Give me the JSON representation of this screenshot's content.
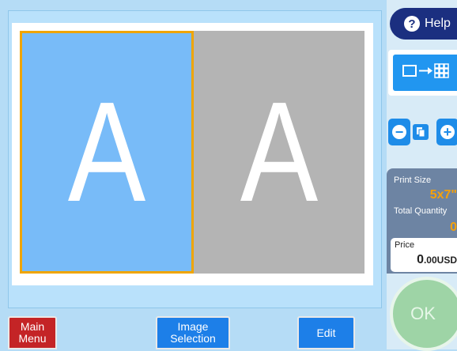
{
  "header": {
    "help_label": "Help"
  },
  "layout_button": {
    "icon": "single-to-grid-icon"
  },
  "zoom": {
    "minus": "−",
    "plus": "+",
    "icon": "page-icon"
  },
  "canvas": {
    "slots": [
      {
        "letter": "A",
        "selected": true,
        "color": "#78bbf8"
      },
      {
        "letter": "A",
        "selected": false,
        "color": "#b4b4b4"
      }
    ]
  },
  "info": {
    "print_size_label": "Print Size",
    "print_size_value": "5x7\"",
    "total_quantity_label": "Total Quantity",
    "total_quantity_value": "0",
    "price_label": "Price",
    "price_value_main": "0",
    "price_value_rest": ".00USD"
  },
  "buttons": {
    "main_menu_line1": "Main",
    "main_menu_line2": "Menu",
    "image_selection_line1": "Image",
    "image_selection_line2": "Selection",
    "edit": "Edit",
    "ok": "OK"
  },
  "colors": {
    "selection_border": "#f0a500",
    "accent_blue": "#1e8ce8",
    "help_navy": "#1b2f80",
    "main_menu_red": "#c42426",
    "ok_green": "#9ed4a6"
  }
}
